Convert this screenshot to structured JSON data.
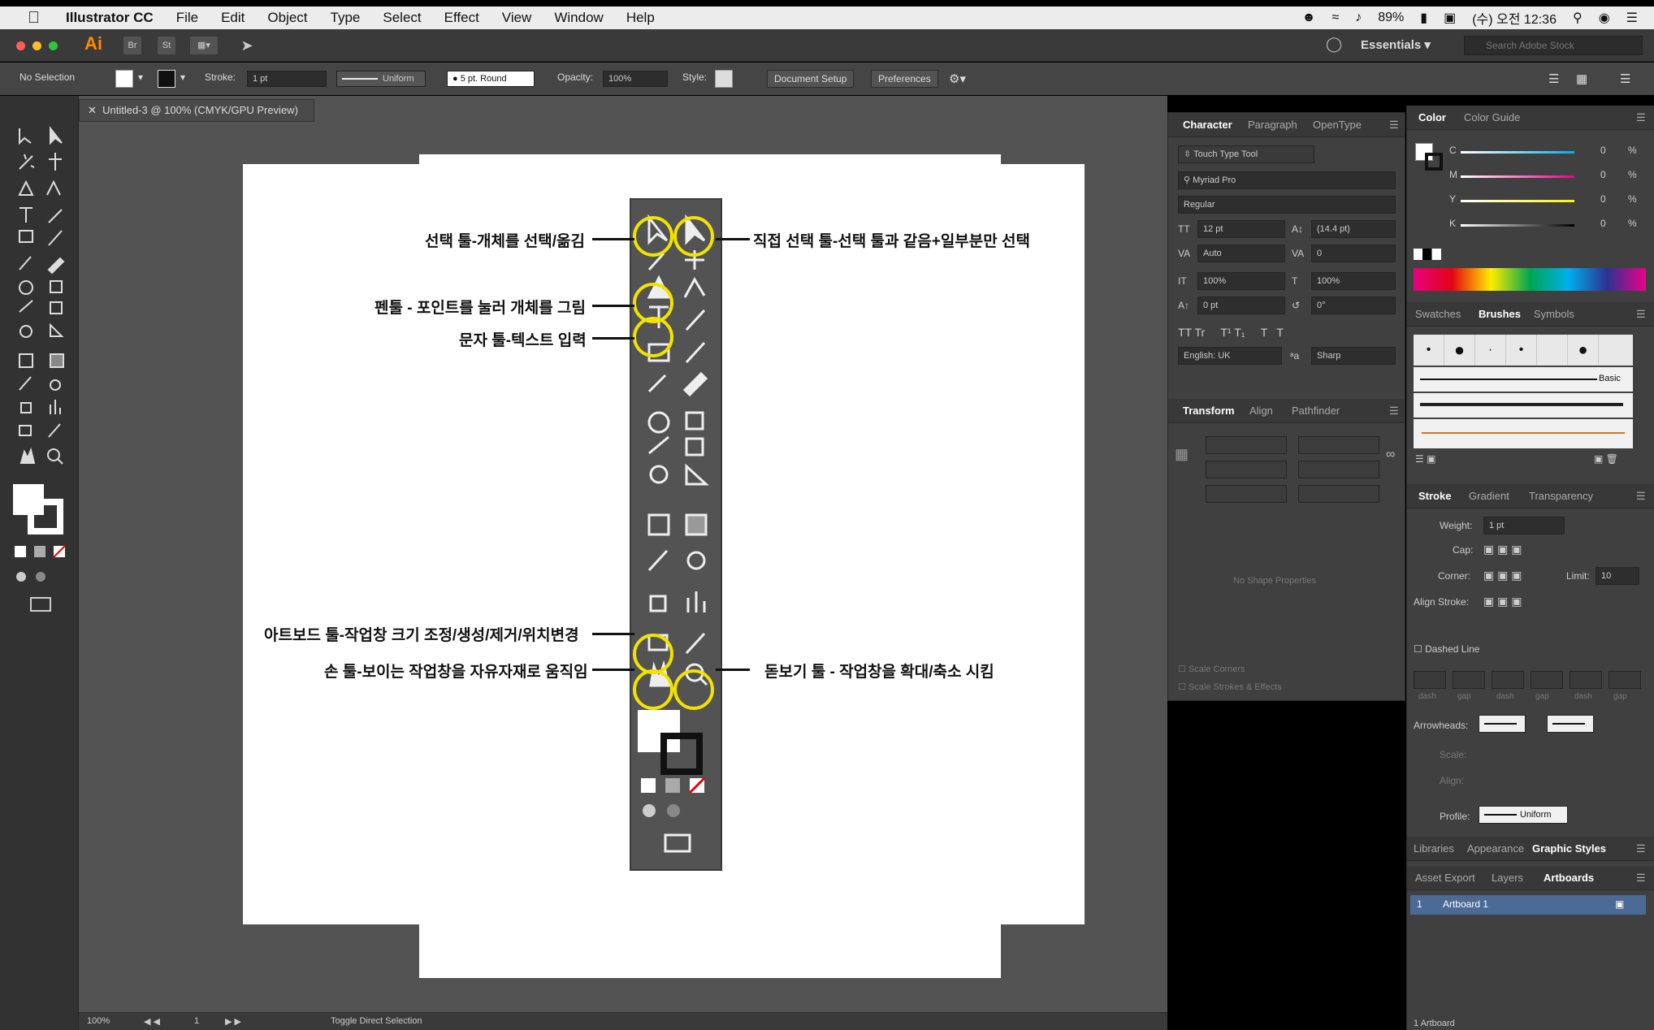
{
  "menubar": {
    "apple": "",
    "app": "Illustrator CC",
    "items": [
      "File",
      "Edit",
      "Object",
      "Type",
      "Select",
      "Effect",
      "View",
      "Window",
      "Help"
    ],
    "battery": "89%",
    "clock": "(수) 오전 12:36"
  },
  "appbar": {
    "logo": "Ai",
    "workspace": "Essentials",
    "stock_placeholder": "Search Adobe Stock"
  },
  "controlbar": {
    "selection": "No Selection",
    "stroke_label": "Stroke:",
    "stroke_value": "1 pt",
    "profile": "Uniform",
    "brush": "5 pt. Round",
    "opacity_label": "Opacity:",
    "opacity_value": "100%",
    "style_label": "Style:",
    "document_setup": "Document Setup",
    "preferences": "Preferences"
  },
  "document": {
    "tab_title": "Untitled-3 @ 100% (CMYK/GPU Preview)"
  },
  "annotations": {
    "select": "선택 툴-개체를 선택/옮김",
    "direct_select": "직접 선택 툴-선택 툴과 같음+일부분만 선택",
    "pen": "펜툴 - 포인트를 눌러 개체를 그림",
    "type": "문자 툴-텍스트 입력",
    "artboard": "아트보드 툴-작업창 크기 조정/생성/제거/위치변경",
    "hand": "손 툴-보이는 작업창을 자유자재로 움직임",
    "zoom": "돋보기 툴 - 작업창을 확대/축소 시킴"
  },
  "character_panel": {
    "tabs": [
      "Character",
      "Paragraph",
      "OpenType"
    ],
    "touch_type": "Touch Type Tool",
    "font": "Myriad Pro",
    "style": "Regular",
    "size": "12 pt",
    "leading": "(14.4 pt)",
    "kerning": "Auto",
    "tracking": "0",
    "vscale": "100%",
    "hscale": "100%",
    "baseline": "0 pt",
    "rotation": "0°",
    "language": "English: UK",
    "antialias": "Sharp"
  },
  "transform_panel": {
    "tabs": [
      "Transform",
      "Align",
      "Pathfinder"
    ],
    "no_shape": "No Shape Properties",
    "scale_corners": "Scale Corners",
    "scale_strokes": "Scale Strokes & Effects"
  },
  "color_panel": {
    "tabs": [
      "Color",
      "Color Guide"
    ],
    "channels": [
      "C",
      "M",
      "Y",
      "K"
    ],
    "values": [
      "0",
      "0",
      "0",
      "0"
    ],
    "unit": "%"
  },
  "brushes_panel": {
    "tabs": [
      "Swatches",
      "Brushes",
      "Symbols"
    ],
    "basic": "Basic"
  },
  "stroke_panel": {
    "tabs": [
      "Stroke",
      "Gradient",
      "Transparency"
    ],
    "weight_label": "Weight:",
    "weight": "1 pt",
    "cap_label": "Cap:",
    "corner_label": "Corner:",
    "limit_label": "Limit:",
    "limit": "10",
    "align_label": "Align Stroke:",
    "dashed": "Dashed Line",
    "dash_labels": [
      "dash",
      "gap",
      "dash",
      "gap",
      "dash",
      "gap"
    ],
    "arrowheads_label": "Arrowheads:",
    "scale_label": "Scale:",
    "align2_label": "Align:",
    "profile_label": "Profile:",
    "profile": "Uniform"
  },
  "bottom_tabs1": [
    "Libraries",
    "Appearance",
    "Graphic Styles"
  ],
  "bottom_tabs2": [
    "Asset Export",
    "Layers",
    "Artboards"
  ],
  "artboards": {
    "row_index": "1",
    "row_name": "Artboard 1",
    "count": "1 Artboard"
  },
  "statusbar": {
    "zoom": "100%",
    "page": "1",
    "tool": "Toggle Direct Selection"
  },
  "colors": {
    "highlight": "#f2e200",
    "ai_orange": "#ff8a00"
  }
}
